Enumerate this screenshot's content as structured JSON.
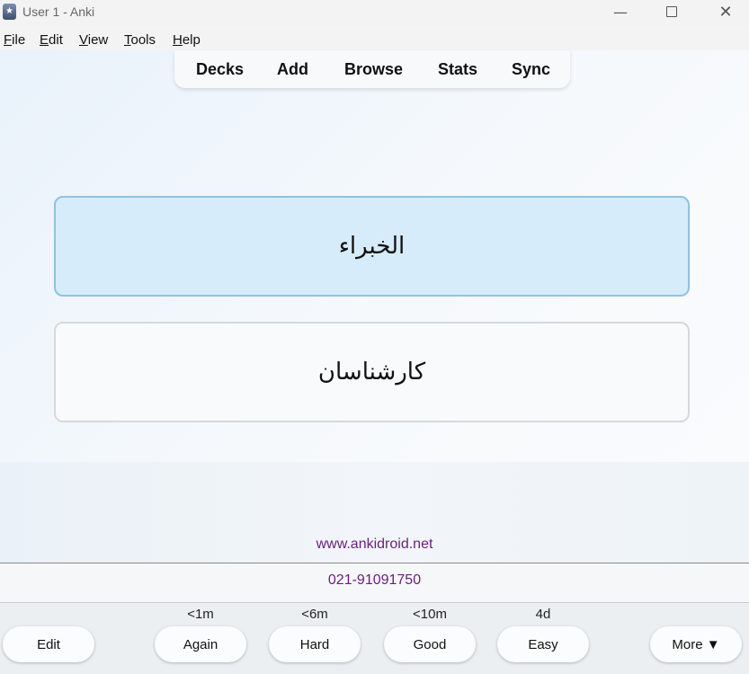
{
  "window": {
    "title": "User 1 - Anki",
    "minimize": "—",
    "close": "✕"
  },
  "menu": {
    "items": [
      "File",
      "Edit",
      "View",
      "Tools",
      "Help"
    ]
  },
  "toolbar": {
    "items": [
      "Decks",
      "Add",
      "Browse",
      "Stats",
      "Sync"
    ]
  },
  "card": {
    "front": "الخبراء",
    "back": "کارشناسان"
  },
  "footer": {
    "url": "www.ankidroid.net",
    "phone": "021-91091750"
  },
  "answer": {
    "edit_label": "Edit",
    "more_label": "More ▼",
    "buttons": [
      {
        "label": "Again",
        "due": "<1m"
      },
      {
        "label": "Hard",
        "due": "<6m"
      },
      {
        "label": "Good",
        "due": "<10m"
      },
      {
        "label": "Easy",
        "due": "4d"
      }
    ]
  },
  "colors": {
    "card_front_bg": "#d6ecfb",
    "card_front_border": "#8ec3df",
    "link": "#6a1f7c"
  }
}
